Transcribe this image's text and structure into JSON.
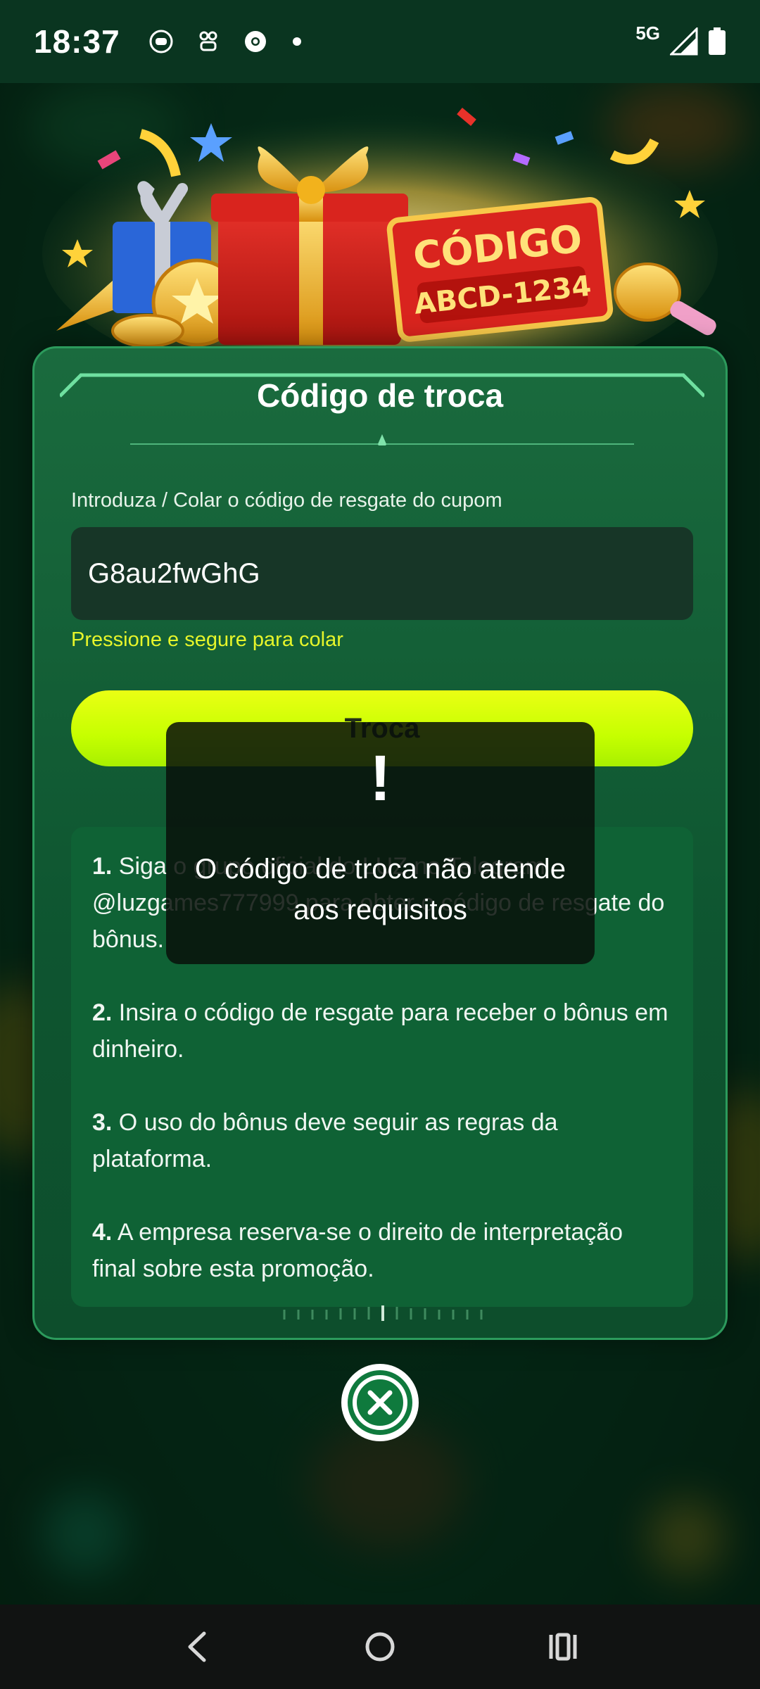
{
  "status_bar": {
    "time": "18:37",
    "network": "5G",
    "icons": [
      "notification-icon",
      "app-icon",
      "chrome-icon",
      "dot-icon",
      "signal-icon",
      "battery-icon"
    ]
  },
  "banner": {
    "code_word": "CÓDIGO",
    "code_value": "ABCD-1234"
  },
  "dialog": {
    "title": "Código de troca",
    "input_label": "Introduza / Colar o código de resgate do cupom",
    "input_value": "G8au2fwGhG",
    "paste_hint": "Pressione e segure para colar",
    "submit_label": "Troca",
    "rules": [
      {
        "num": "1.",
        "text": " Siga o grupo oficial do LUZ no Telegram @luzgames777999 para obter o código de resgate do bônus."
      },
      {
        "num": "2.",
        "text": " Insira o código de resgate para receber o bônus em dinheiro."
      },
      {
        "num": "3.",
        "text": " O uso do bônus deve seguir as regras da plataforma."
      },
      {
        "num": "4.",
        "text": " A empresa reserva-se o direito de interpretação final sobre esta promoção."
      }
    ]
  },
  "toast": {
    "mark": "!",
    "message": "O código de troca não atende aos requisitos"
  },
  "colors": {
    "accent_yellow": "#e6f52a",
    "button_green_yellow": "#c6ff00",
    "dialog_green": "#0e5530",
    "close_green": "#0f7a3d"
  }
}
